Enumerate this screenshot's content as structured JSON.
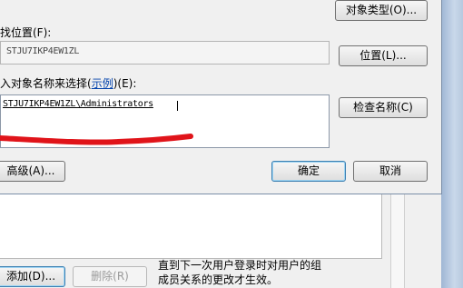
{
  "dialog": {
    "object_types_button": "对象类型(O)...",
    "location_label": "找位置(F):",
    "location_value": "STJU7IKP4EW1ZL",
    "locations_button": "位置(L)...",
    "names_label_prefix": "入对象名称来选择(",
    "names_label_link": "示例",
    "names_label_suffix": ")(E):",
    "names_value": "STJU7IKP4EW1ZL\\Administrators",
    "check_names_button": "检查名称(C)",
    "advanced_button": "高级(A)...",
    "ok_button": "确定",
    "cancel_button": "取消"
  },
  "background": {
    "add_button": "添加(D)...",
    "remove_button": "删除(R)",
    "notice_line1": "直到下一次用户登录时对用户的组",
    "notice_line2": "成员关系的更改才生效。"
  },
  "colors": {
    "annotation": "#e0141a",
    "link": "#0645ad"
  }
}
